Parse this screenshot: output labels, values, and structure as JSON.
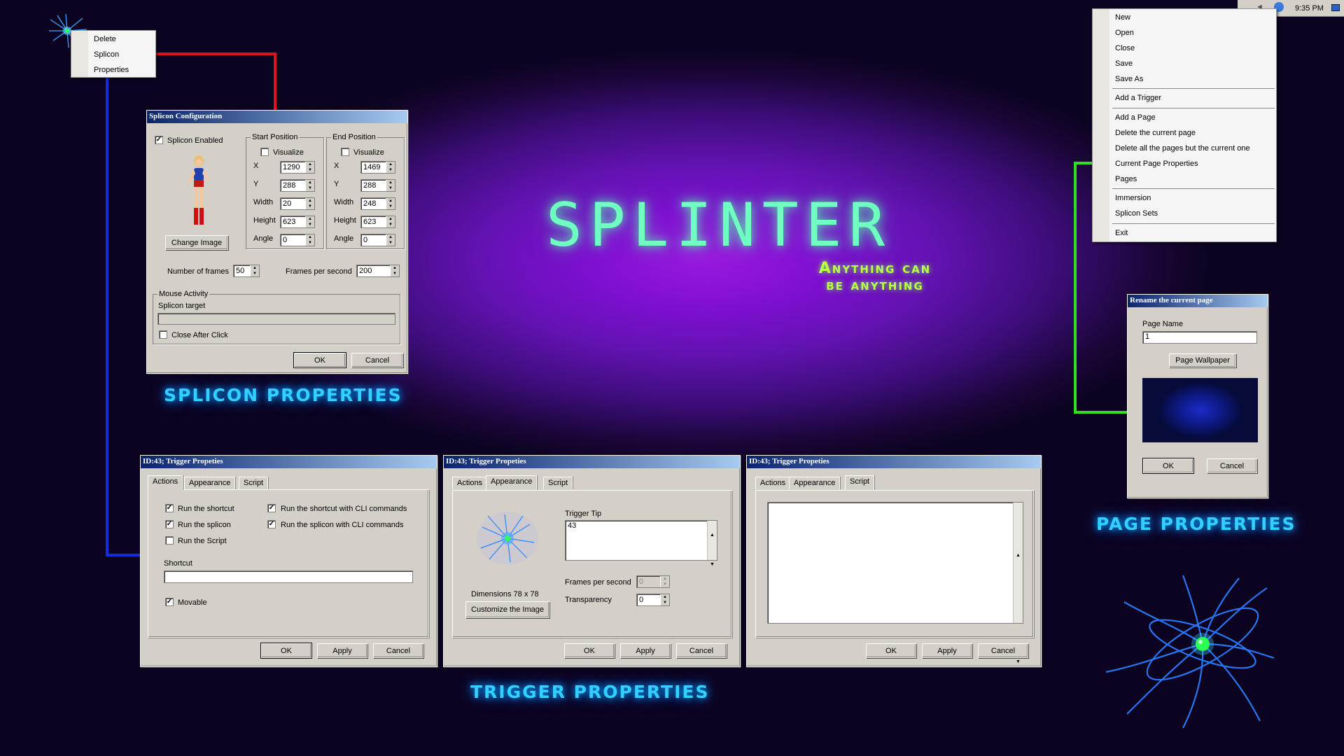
{
  "brand": {
    "title": "SPLINTER",
    "tagline_line1": "Anything can",
    "tagline_line2": "be anything"
  },
  "captions": {
    "splicon": "SPLICON PROPERTIES",
    "trigger": "TRIGGER PROPERTIES",
    "page": "PAGE PROPERTIES"
  },
  "taskbar": {
    "clock": "9:35 PM"
  },
  "context_menu": {
    "items": [
      "Delete",
      "Splicon",
      "Properties"
    ]
  },
  "main_menu": {
    "items": [
      "New",
      "Open",
      "Close",
      "Save",
      "Save As",
      "Add a Trigger",
      "Add a Page",
      "Delete the current page",
      "Delete all the pages but the current one",
      "Current Page Properties",
      "Pages",
      "Immersion",
      "Splicon Sets",
      "Exit"
    ]
  },
  "splicon_config": {
    "title": "Splicon Configuration",
    "enabled_label": "Splicon Enabled",
    "change_image": "Change Image",
    "start_position": {
      "label": "Start Position",
      "visualize": "Visualize",
      "x": "1290",
      "y": "288",
      "width": "20",
      "height": "623",
      "angle": "0"
    },
    "end_position": {
      "label": "End Position",
      "visualize": "Visualize",
      "x": "1469",
      "y": "288",
      "width": "248",
      "height": "623",
      "angle": "0"
    },
    "field_labels": {
      "x": "X",
      "y": "Y",
      "width": "Width",
      "height": "Height",
      "angle": "Angle"
    },
    "frames_label": "Number of frames",
    "frames": "50",
    "fps_label": "Frames per second",
    "fps": "200",
    "mouse_activity": "Mouse Activity",
    "splicon_target": "Splicon target",
    "close_after_click": "Close After Click",
    "ok": "OK",
    "cancel": "Cancel"
  },
  "trigger_dialogs": {
    "title": "ID:43; Trigger Propeties",
    "tabs": [
      "Actions",
      "Appearance",
      "Script"
    ],
    "ok": "OK",
    "apply": "Apply",
    "cancel": "Cancel",
    "actions": {
      "run_shortcut": "Run the shortcut",
      "run_shortcut_cli": "Run the shortcut with CLI commands",
      "run_splicon": "Run the splicon",
      "run_splicon_cli": "Run the splicon with CLI commands",
      "run_script": "Run the Script",
      "shortcut_label": "Shortcut",
      "movable": "Movable"
    },
    "appearance": {
      "trigger_tip_label": "Trigger Tip",
      "trigger_tip": "43",
      "dimensions": "Dimensions 78 x 78",
      "customize": "Customize the Image",
      "fps_label": "Frames per second",
      "fps": "0",
      "transparency_label": "Transparency",
      "transparency": "0"
    }
  },
  "rename_page": {
    "title": "Rename the current page",
    "page_name_label": "Page Name",
    "page_name": "1",
    "wallpaper_button": "Page Wallpaper",
    "ok": "OK",
    "cancel": "Cancel"
  },
  "colors": {
    "connector_red": "#e01020",
    "connector_blue": "#1030e0",
    "connector_green": "#30e020",
    "title_glow": "#6fffc0",
    "caption": "#31d0ff"
  }
}
